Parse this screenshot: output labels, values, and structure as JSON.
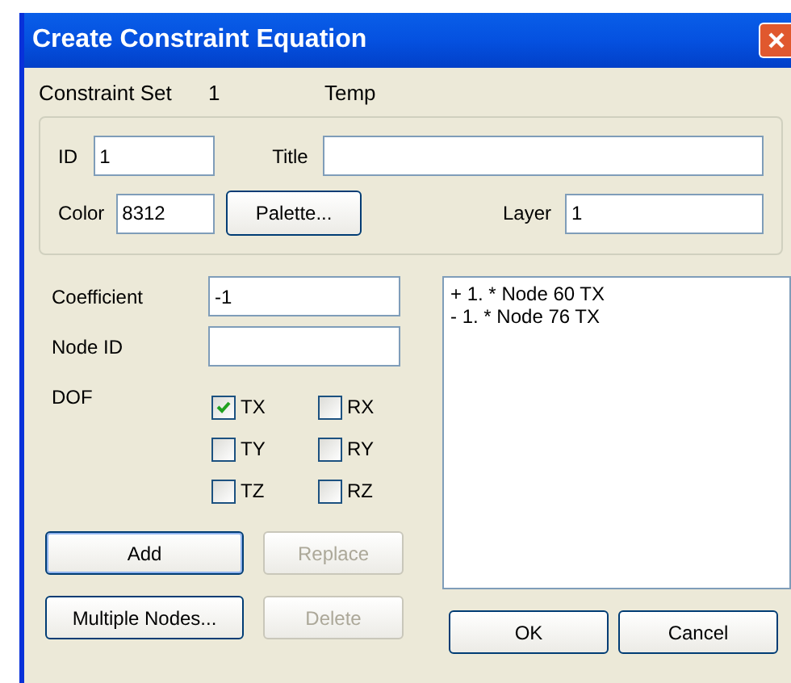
{
  "window": {
    "title": "Create Constraint Equation"
  },
  "header": {
    "label": "Constraint Set",
    "set_number": "1",
    "set_title": "Temp"
  },
  "properties": {
    "id": {
      "label": "ID",
      "value": "1"
    },
    "title": {
      "label": "Title"
    },
    "color": {
      "label": "Color",
      "value": "8312"
    },
    "palette_button": "Palette...",
    "layer": {
      "label": "Layer",
      "value": "1"
    }
  },
  "coefficient": {
    "label": "Coefficient",
    "value": "-1"
  },
  "node_id": {
    "label": "Node ID"
  },
  "dof": {
    "label": "DOF",
    "options": [
      {
        "label": "TX",
        "checked": true
      },
      {
        "label": "RX",
        "checked": false
      },
      {
        "label": "TY",
        "checked": false
      },
      {
        "label": "RY",
        "checked": false
      },
      {
        "label": "TZ",
        "checked": false
      },
      {
        "label": "RZ",
        "checked": false
      }
    ]
  },
  "equation_terms": [
    "+ 1. * Node 60 TX",
    "- 1. * Node 76 TX"
  ],
  "edit_buttons": [
    {
      "label": "Add",
      "disabled": false,
      "default": true
    },
    {
      "label": "Replace",
      "disabled": true,
      "default": false
    },
    {
      "label": "Multiple Nodes...",
      "disabled": false,
      "default": false
    },
    {
      "label": "Delete",
      "disabled": true,
      "default": false
    }
  ],
  "dialog_buttons": [
    {
      "label": "OK",
      "disabled": false
    },
    {
      "label": "Cancel",
      "disabled": false
    }
  ]
}
